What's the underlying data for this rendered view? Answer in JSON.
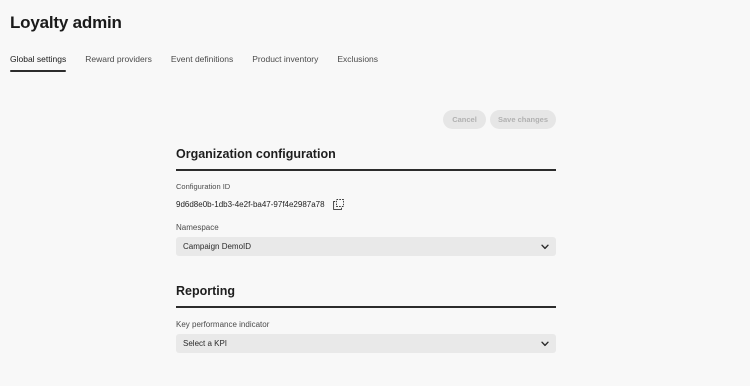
{
  "app": {
    "title": "Loyalty admin"
  },
  "tabs": [
    {
      "label": "Global settings",
      "active": true
    },
    {
      "label": "Reward providers",
      "active": false
    },
    {
      "label": "Event definitions",
      "active": false
    },
    {
      "label": "Product inventory",
      "active": false
    },
    {
      "label": "Exclusions",
      "active": false
    }
  ],
  "actions": {
    "cancel_label": "Cancel",
    "save_label": "Save changes",
    "disabled": true
  },
  "org_config": {
    "title": "Organization configuration",
    "config_id_label": "Configuration ID",
    "config_id_value": "9d6d8e0b-1db3-4e2f-ba47-97f4e2987a78",
    "copy_icon": "copy-icon",
    "namespace_label": "Namespace",
    "namespace_value": "Campaign DemoID",
    "dropdown_icon": "chevron-down-icon"
  },
  "reporting": {
    "title": "Reporting",
    "kpi_label": "Key performance indicator",
    "kpi_placeholder": "Select a KPI",
    "dropdown_icon": "chevron-down-icon"
  },
  "colors": {
    "background": "#f8f8f8",
    "rule": "#2c2c2c",
    "select_bg": "#e9e9e9",
    "button_disabled_bg": "#e6e6e6",
    "button_disabled_text": "#b1b1b1"
  }
}
